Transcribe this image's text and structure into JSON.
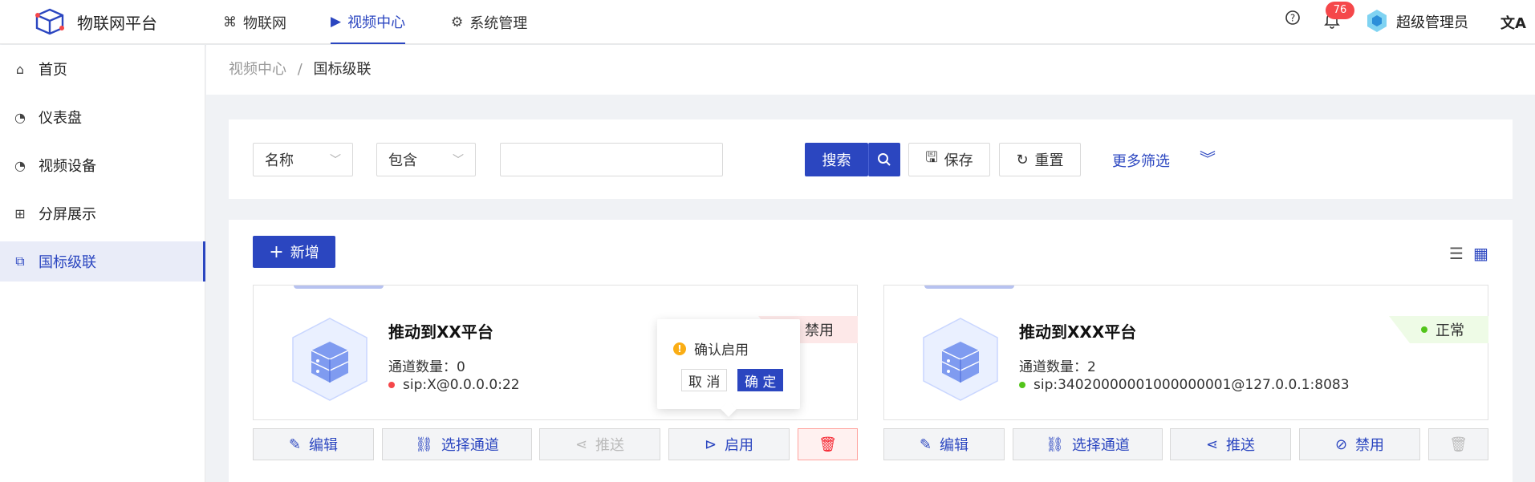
{
  "app": {
    "title": "物联网平台"
  },
  "topnav": [
    {
      "label": "物联网",
      "icon": "iot-icon"
    },
    {
      "label": "视频中心",
      "icon": "video-play-icon"
    },
    {
      "label": "系统管理",
      "icon": "settings-icon"
    }
  ],
  "header": {
    "notification_count": "76",
    "user": "超级管理员"
  },
  "sidebar": {
    "items": [
      {
        "label": "首页",
        "icon": "home-icon"
      },
      {
        "label": "仪表盘",
        "icon": "dashboard-icon"
      },
      {
        "label": "视频设备",
        "icon": "video-device-icon"
      },
      {
        "label": "分屏展示",
        "icon": "split-screen-icon"
      },
      {
        "label": "国标级联",
        "icon": "cascade-icon"
      }
    ]
  },
  "breadcrumb": {
    "parent": "视频中心",
    "separator": "/",
    "current": "国标级联"
  },
  "filter": {
    "field": "名称",
    "operator": "包含",
    "value": "",
    "search_label": "搜索",
    "save_label": "保存",
    "reset_label": "重置",
    "more_label": "更多筛选"
  },
  "toolbar": {
    "add_label": "新增"
  },
  "cards": [
    {
      "title": "推动到XX平台",
      "channel_label": "通道数量：",
      "channel_count": "0",
      "sip": "sip:X@0.0.0.0:22",
      "status": "禁用",
      "status_color": "#f5474a",
      "actions": [
        "编辑",
        "选择通道",
        "推送",
        "启用"
      ]
    },
    {
      "title": "推动到XXX平台",
      "channel_label": "通道数量：",
      "channel_count": "2",
      "sip": "sip:34020000001000000001@127.0.0.1:8083",
      "status": "正常",
      "status_color": "#52c41a",
      "actions": [
        "编辑",
        "选择通道",
        "推送",
        "禁用"
      ]
    }
  ],
  "popconfirm": {
    "message": "确认启用",
    "cancel": "取 消",
    "ok": "确 定"
  },
  "colors": {
    "primary": "#2b46c0",
    "danger": "#f5474a",
    "success": "#52c41a"
  }
}
